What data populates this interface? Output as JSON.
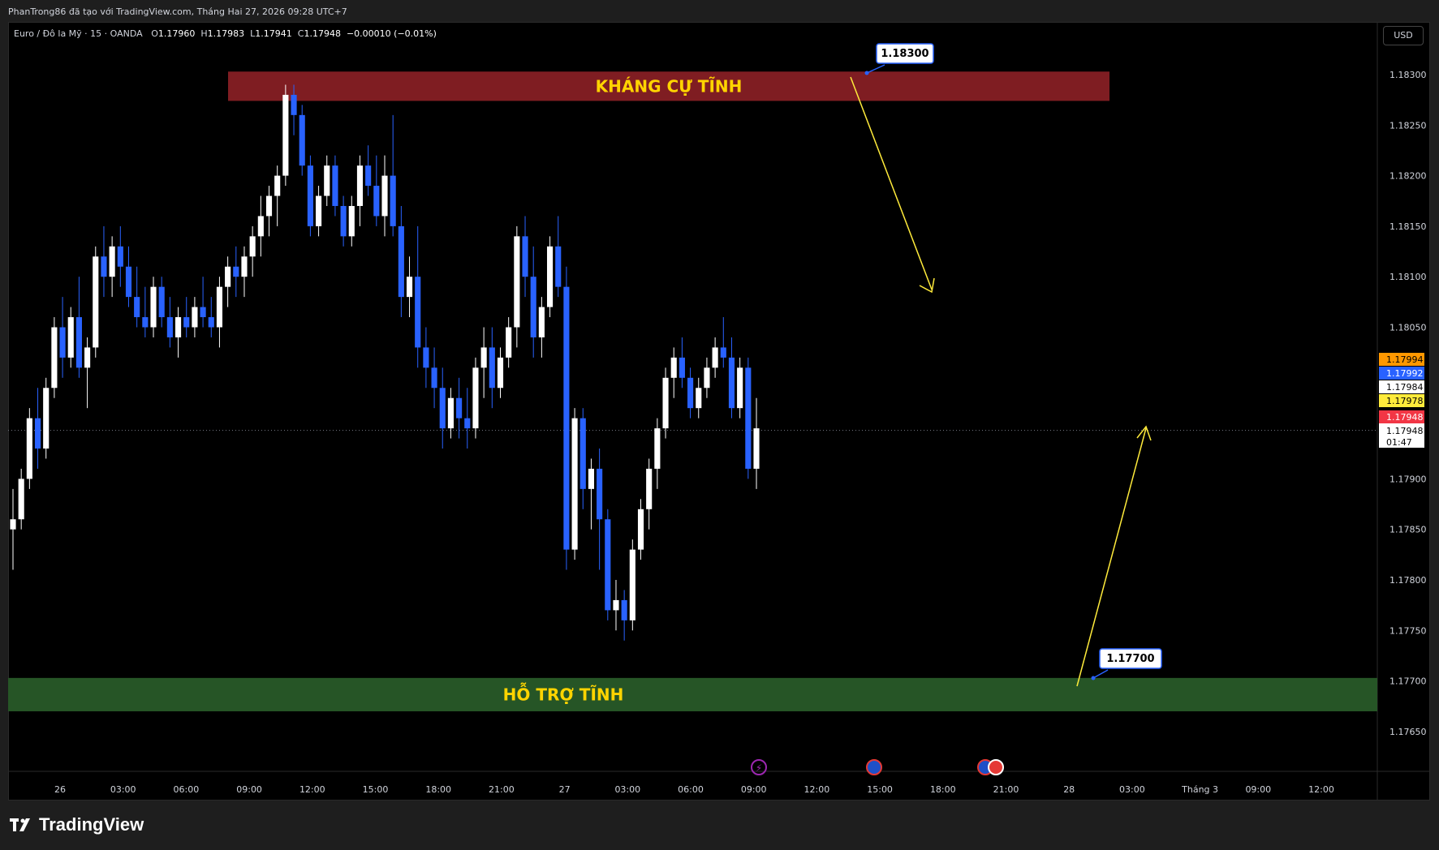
{
  "header": {
    "publisher_line": "PhanTrong86 đã tạo với TradingView.com, Tháng Hai 27, 2026 09:28 UTC+7"
  },
  "legend": {
    "symbol": "Euro / Đô la Mỹ · 15 · OANDA",
    "o_label": "O",
    "o_value": "1.17960",
    "h_label": "H",
    "h_value": "1.17983",
    "l_label": "L",
    "l_value": "1.17941",
    "c_label": "C",
    "c_value": "1.17948",
    "change": "−0.00010 (−0.01%)"
  },
  "currency_button": "USD",
  "footer": {
    "brand": "TradingView"
  },
  "colors": {
    "bull": "#ffffff",
    "bear": "#2962ff",
    "resistance_zone": "#7f1d22",
    "support_zone": "#265526",
    "zone_text": "#ffd400",
    "arrow": "#ffeb3b"
  },
  "chart_data": {
    "type": "candlestick",
    "symbol": "EURUSD",
    "timeframe": "15",
    "ylim": [
      1.1762,
      1.1834
    ],
    "y_ticks": [
      "1.18300",
      "1.18250",
      "1.18200",
      "1.18150",
      "1.18100",
      "1.18050",
      "1.17900",
      "1.17850",
      "1.17800",
      "1.17750",
      "1.17700",
      "1.17650"
    ],
    "x_ticks": [
      "26",
      "03:00",
      "06:00",
      "09:00",
      "12:00",
      "15:00",
      "18:00",
      "21:00",
      "27",
      "03:00",
      "06:00",
      "09:00",
      "12:00",
      "15:00",
      "18:00",
      "21:00",
      "28",
      "03:00",
      "Tháng 3",
      "09:00",
      "12:00"
    ],
    "bull_color": "#ffffff",
    "bear_color": "#2962ff",
    "candles": [
      [
        1.1785,
        1.1789,
        1.1781,
        1.1786
      ],
      [
        1.1786,
        1.1791,
        1.1785,
        1.179
      ],
      [
        1.179,
        1.1797,
        1.1789,
        1.1796
      ],
      [
        1.1796,
        1.1799,
        1.1791,
        1.1793
      ],
      [
        1.1793,
        1.18,
        1.1792,
        1.1799
      ],
      [
        1.1799,
        1.1806,
        1.1798,
        1.1805
      ],
      [
        1.1805,
        1.1808,
        1.18,
        1.1802
      ],
      [
        1.1802,
        1.1807,
        1.1801,
        1.1806
      ],
      [
        1.1806,
        1.181,
        1.18,
        1.1801
      ],
      [
        1.1801,
        1.1804,
        1.1797,
        1.1803
      ],
      [
        1.1803,
        1.1813,
        1.1802,
        1.1812
      ],
      [
        1.1812,
        1.1815,
        1.1808,
        1.181
      ],
      [
        1.181,
        1.1814,
        1.1808,
        1.1813
      ],
      [
        1.1813,
        1.1815,
        1.1809,
        1.1811
      ],
      [
        1.1811,
        1.1813,
        1.1807,
        1.1808
      ],
      [
        1.1808,
        1.1811,
        1.1805,
        1.1806
      ],
      [
        1.1806,
        1.1809,
        1.1804,
        1.1805
      ],
      [
        1.1805,
        1.181,
        1.1804,
        1.1809
      ],
      [
        1.1809,
        1.181,
        1.1805,
        1.1806
      ],
      [
        1.1806,
        1.1808,
        1.1803,
        1.1804
      ],
      [
        1.1804,
        1.1807,
        1.1802,
        1.1806
      ],
      [
        1.1806,
        1.1808,
        1.1804,
        1.1805
      ],
      [
        1.1805,
        1.1808,
        1.1804,
        1.1807
      ],
      [
        1.1807,
        1.181,
        1.1805,
        1.1806
      ],
      [
        1.1806,
        1.1808,
        1.1804,
        1.1805
      ],
      [
        1.1805,
        1.181,
        1.1803,
        1.1809
      ],
      [
        1.1809,
        1.1812,
        1.1807,
        1.1811
      ],
      [
        1.1811,
        1.1813,
        1.1808,
        1.181
      ],
      [
        1.181,
        1.1813,
        1.1808,
        1.1812
      ],
      [
        1.1812,
        1.1815,
        1.181,
        1.1814
      ],
      [
        1.1814,
        1.1818,
        1.1812,
        1.1816
      ],
      [
        1.1816,
        1.1819,
        1.1814,
        1.1818
      ],
      [
        1.1818,
        1.1821,
        1.1815,
        1.182
      ],
      [
        1.182,
        1.1829,
        1.1819,
        1.1828
      ],
      [
        1.1828,
        1.1829,
        1.1824,
        1.1826
      ],
      [
        1.1826,
        1.1827,
        1.182,
        1.1821
      ],
      [
        1.1821,
        1.1822,
        1.1814,
        1.1815
      ],
      [
        1.1815,
        1.1819,
        1.1814,
        1.1818
      ],
      [
        1.1818,
        1.1822,
        1.1817,
        1.1821
      ],
      [
        1.1821,
        1.1822,
        1.1816,
        1.1817
      ],
      [
        1.1817,
        1.1818,
        1.1813,
        1.1814
      ],
      [
        1.1814,
        1.1818,
        1.1813,
        1.1817
      ],
      [
        1.1817,
        1.1822,
        1.1815,
        1.1821
      ],
      [
        1.1821,
        1.1823,
        1.1818,
        1.1819
      ],
      [
        1.1819,
        1.1822,
        1.1815,
        1.1816
      ],
      [
        1.1816,
        1.1822,
        1.1814,
        1.182
      ],
      [
        1.182,
        1.1826,
        1.1814,
        1.1815
      ],
      [
        1.1815,
        1.1817,
        1.1806,
        1.1808
      ],
      [
        1.1808,
        1.1812,
        1.1806,
        1.181
      ],
      [
        1.181,
        1.1815,
        1.1801,
        1.1803
      ],
      [
        1.1803,
        1.1805,
        1.1799,
        1.1801
      ],
      [
        1.1801,
        1.1803,
        1.1797,
        1.1799
      ],
      [
        1.1799,
        1.1801,
        1.1793,
        1.1795
      ],
      [
        1.1795,
        1.1799,
        1.1794,
        1.1798
      ],
      [
        1.1798,
        1.18,
        1.1794,
        1.1796
      ],
      [
        1.1796,
        1.1799,
        1.1793,
        1.1795
      ],
      [
        1.1795,
        1.1802,
        1.1794,
        1.1801
      ],
      [
        1.1801,
        1.1805,
        1.1798,
        1.1803
      ],
      [
        1.1803,
        1.1805,
        1.1797,
        1.1799
      ],
      [
        1.1799,
        1.1803,
        1.1798,
        1.1802
      ],
      [
        1.1802,
        1.1806,
        1.1801,
        1.1805
      ],
      [
        1.1805,
        1.1815,
        1.1803,
        1.1814
      ],
      [
        1.1814,
        1.1816,
        1.1808,
        1.181
      ],
      [
        1.181,
        1.1813,
        1.1802,
        1.1804
      ],
      [
        1.1804,
        1.1808,
        1.1802,
        1.1807
      ],
      [
        1.1807,
        1.1814,
        1.1806,
        1.1813
      ],
      [
        1.1813,
        1.1816,
        1.1808,
        1.1809
      ],
      [
        1.1809,
        1.1811,
        1.1781,
        1.1783
      ],
      [
        1.1783,
        1.1797,
        1.1782,
        1.1796
      ],
      [
        1.1796,
        1.1797,
        1.1787,
        1.1789
      ],
      [
        1.1789,
        1.1792,
        1.1785,
        1.1791
      ],
      [
        1.1791,
        1.1793,
        1.1781,
        1.1786
      ],
      [
        1.1786,
        1.1787,
        1.1776,
        1.1777
      ],
      [
        1.1777,
        1.178,
        1.1775,
        1.1778
      ],
      [
        1.1778,
        1.1779,
        1.1774,
        1.1776
      ],
      [
        1.1776,
        1.1784,
        1.1775,
        1.1783
      ],
      [
        1.1783,
        1.1788,
        1.1782,
        1.1787
      ],
      [
        1.1787,
        1.1792,
        1.1785,
        1.1791
      ],
      [
        1.1791,
        1.1796,
        1.1789,
        1.1795
      ],
      [
        1.1795,
        1.1801,
        1.1794,
        1.18
      ],
      [
        1.18,
        1.1803,
        1.1798,
        1.1802
      ],
      [
        1.1802,
        1.1804,
        1.1799,
        1.18
      ],
      [
        1.18,
        1.1801,
        1.1796,
        1.1797
      ],
      [
        1.1797,
        1.18,
        1.1796,
        1.1799
      ],
      [
        1.1799,
        1.1802,
        1.1798,
        1.1801
      ],
      [
        1.1801,
        1.1804,
        1.18,
        1.1803
      ],
      [
        1.1803,
        1.1806,
        1.1801,
        1.1802
      ],
      [
        1.1802,
        1.1804,
        1.1796,
        1.1797
      ],
      [
        1.1797,
        1.1802,
        1.1796,
        1.1801
      ],
      [
        1.1801,
        1.1802,
        1.179,
        1.1791
      ],
      [
        1.1791,
        1.1798,
        1.1789,
        1.1795
      ]
    ],
    "zones": [
      {
        "label": "KHÁNG CỰ TĨNH",
        "top": 1.18303,
        "bottom": 1.18274
      },
      {
        "label": "HỖ TRỢ TĨNH",
        "top": 1.17703,
        "bottom": 1.1767
      }
    ],
    "level_callouts": [
      "1.18300",
      "1.17700"
    ],
    "price_labels": [
      {
        "text": "1.17994",
        "color": "#ff9800",
        "price": 1.17994
      },
      {
        "text": "1.17992",
        "color": "#2962ff",
        "price": 1.17992
      },
      {
        "text": "1.17984",
        "color": "#ffffff",
        "price": 1.17984
      },
      {
        "text": "1.17978",
        "color": "#ffeb3b",
        "price": 1.17978
      },
      {
        "text": "1.17948",
        "color": "#f23645",
        "price": 1.17948
      }
    ],
    "last_price": "1.17948",
    "countdown": "01:47"
  }
}
